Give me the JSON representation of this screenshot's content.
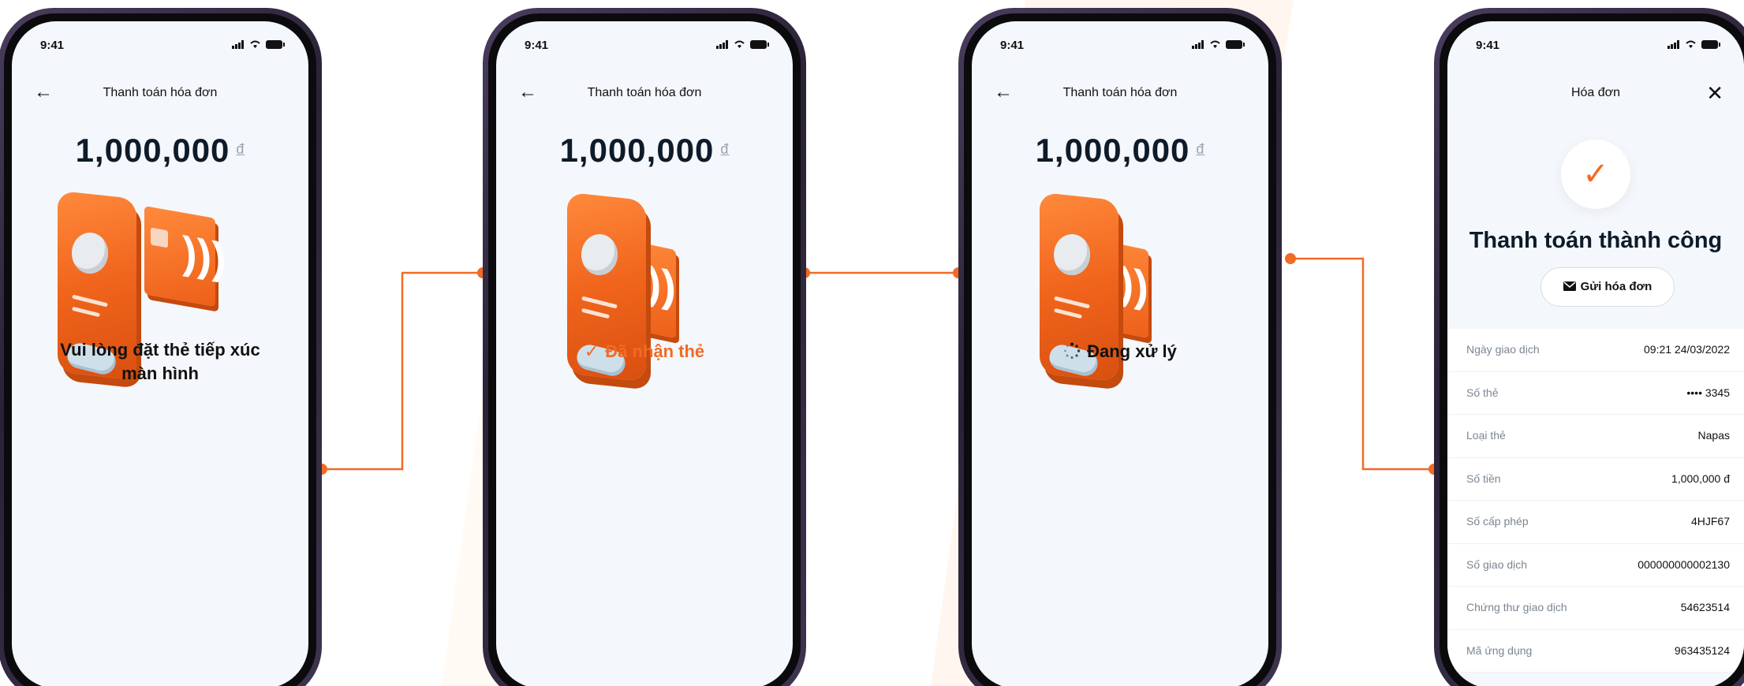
{
  "brand_color": "#f26a24",
  "screens": [
    {
      "time": "9:41",
      "nav_title": "Thanh toán hóa đơn",
      "amount": "1,000,000",
      "currency": "đ",
      "message_line1": "Vui lòng đặt thẻ tiếp xúc",
      "message_line2": "màn hình"
    },
    {
      "time": "9:41",
      "nav_title": "Thanh toán hóa đơn",
      "amount": "1,000,000",
      "currency": "đ",
      "status_icon": "✓",
      "status_text": "Đã nhận thẻ"
    },
    {
      "time": "9:41",
      "nav_title": "Thanh toán hóa đơn",
      "amount": "1,000,000",
      "currency": "đ",
      "status_text": "Đang xử lý"
    },
    {
      "time": "9:41",
      "nav_title": "Hóa đơn",
      "close_icon": "✕",
      "success_icon": "✓",
      "success_title": "Thanh toán thành công",
      "send_button_label": "Gửi hóa đơn",
      "rows": [
        {
          "label": "Ngày giao dịch",
          "value": "09:21 24/03/2022"
        },
        {
          "label": "Số thẻ",
          "value": "•••• 3345"
        },
        {
          "label": "Loại thẻ",
          "value": "Napas"
        },
        {
          "label": "Số tiền",
          "value": "1,000,000 đ"
        },
        {
          "label": "Số cấp phép",
          "value": "4HJF67"
        },
        {
          "label": "Số giao dịch",
          "value": "000000000002130"
        },
        {
          "label": "Chứng thư giao dịch",
          "value": "54623514"
        },
        {
          "label": "Mã ứng dụng",
          "value": "963435124"
        }
      ]
    }
  ]
}
